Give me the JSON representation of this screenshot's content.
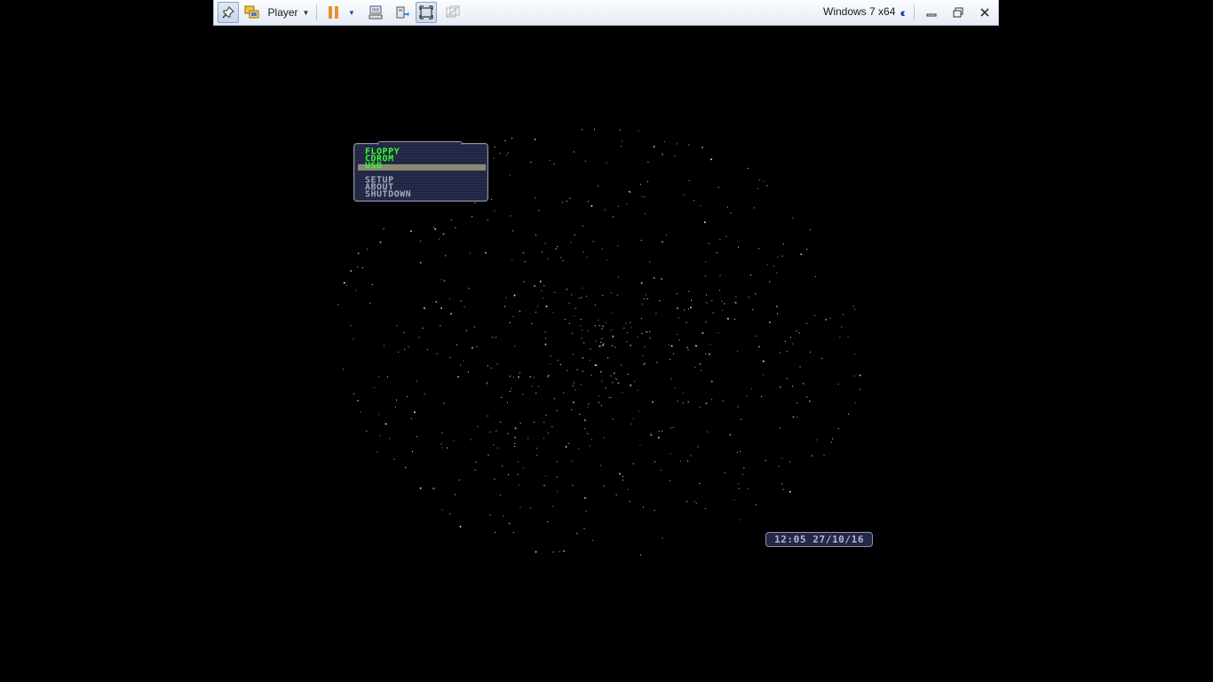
{
  "toolbar": {
    "player_label": "Player",
    "vm_title": "Windows 7 x64"
  },
  "boot_menu": {
    "items": [
      "FLOPPY",
      "CDROM",
      "USB",
      "SETUP",
      "ABOUT",
      "SHUTDOWN"
    ],
    "selected": "USB"
  },
  "clock": {
    "text": "12:05 27/10/16"
  },
  "colors": {
    "menu_active_text": "#33ff2a",
    "menu_inactive_text": "#a5a9bd",
    "menu_background": "#262b4a",
    "selection_bar": "#8b8a70",
    "toolbar_background": "#eef2f8",
    "screen_background": "#000000"
  }
}
